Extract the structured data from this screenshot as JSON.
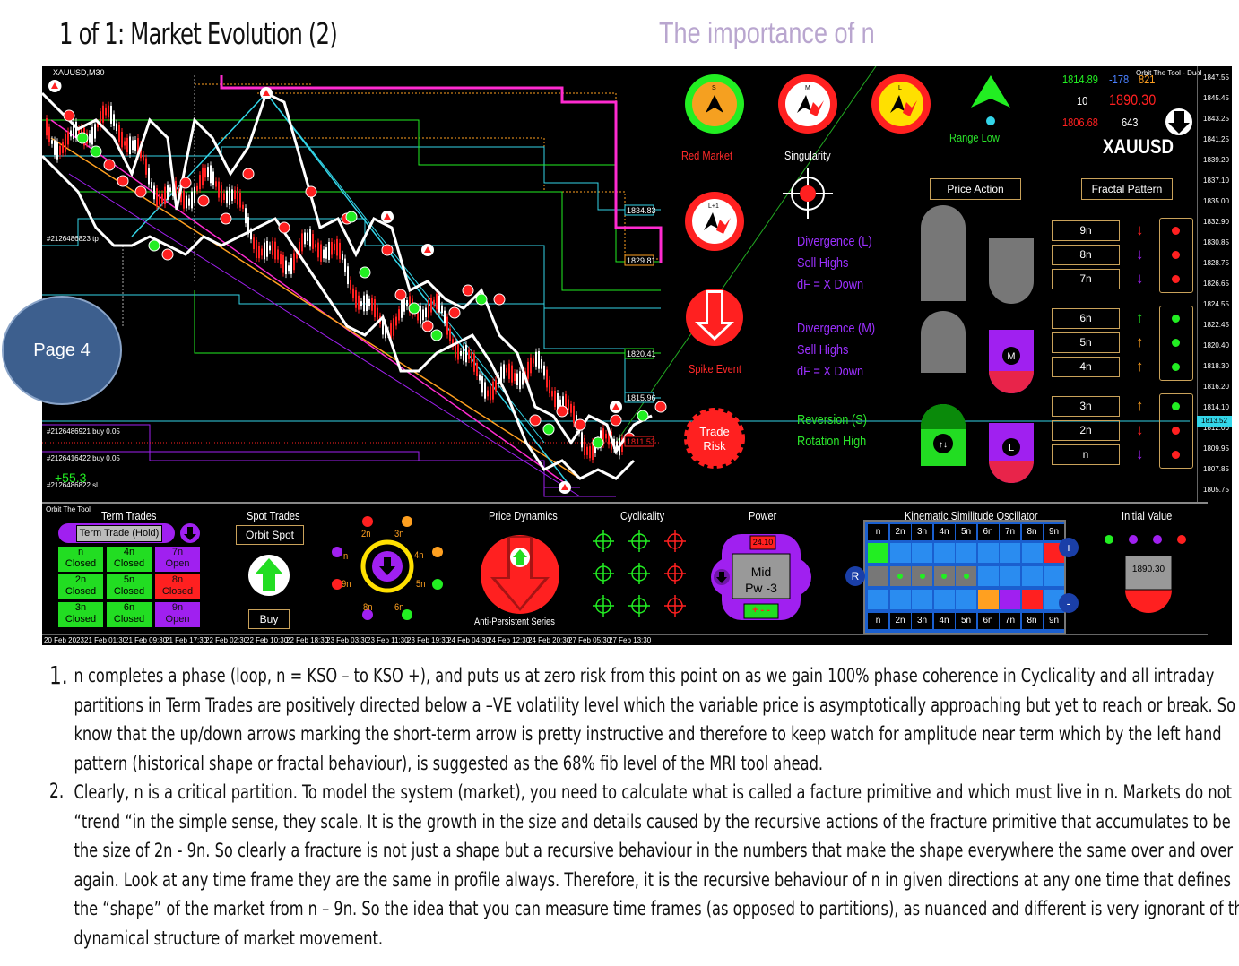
{
  "header": {
    "title": "1 of 1: Market Evolution (2)",
    "subtitle": "The importance of n"
  },
  "badge": {
    "label": "Page 4"
  },
  "platform": {
    "symbol_tf": "XAUUSD,M30",
    "tool_title": "Orbit The Tool - Dual",
    "bottom_title": "Orbit The Tool",
    "level_labels": [
      "1834.83",
      "1829.81",
      "1820.41",
      "1815.96",
      "1811.53"
    ],
    "order_labels": [
      "#2126486823 tp",
      "#2126486921 buy 0.05",
      "#2126416422 buy 0.05",
      "#2126486822 sl"
    ],
    "pnl": "+55.3",
    "price_scale": [
      "1847.55",
      "1845.45",
      "1843.25",
      "1841.25",
      "1839.20",
      "1837.10",
      "1835.00",
      "1832.90",
      "1830.85",
      "1828.75",
      "1826.65",
      "1824.55",
      "1822.45",
      "1820.40",
      "1818.30",
      "1816.20",
      "1814.10",
      "1812.00",
      "1809.95",
      "1807.85",
      "1805.75"
    ],
    "current_price": "1813.52",
    "time_axis": [
      "20 Feb 2023",
      "21 Feb 01:30",
      "21 Feb 09:30",
      "21 Feb 17:30",
      "22 Feb 02:30",
      "22 Feb 10:30",
      "22 Feb 18:30",
      "23 Feb 03:30",
      "23 Feb 11:30",
      "23 Feb 19:30",
      "24 Feb 04:30",
      "24 Feb 12:30",
      "24 Feb 20:30",
      "27 Feb 05:30",
      "27 Feb 13:30"
    ],
    "colors": {
      "red": "#ff2020",
      "green": "#22ee22",
      "purple": "#a020f0",
      "gold": "#c9a25a",
      "cyan": "#33d5e8",
      "magenta": "#ff2bd0"
    }
  },
  "indicators": {
    "red_market": "Red Market",
    "singularity": "Singularity",
    "spike_event": "Spike Event",
    "trade_risk": "Trade Risk",
    "range_low": "Range Low",
    "circle_letters": [
      "S",
      "M",
      "L",
      "L+1"
    ],
    "price_action_button": "Price Action",
    "fractal_pattern_button": "Fractal Pattern",
    "divergence_l": [
      "Divergence (L)",
      "Sell Highs",
      "dF = X Down"
    ],
    "divergence_m": [
      "Divergence (M)",
      "Sell Highs",
      "dF = X Down"
    ],
    "reversion_s": [
      "Reversion (S)",
      "Rotation High"
    ],
    "shape_letters": [
      "M",
      "L"
    ]
  },
  "quote": {
    "v1": "1814.89",
    "v2": "-178",
    "v3": "821",
    "v4": "10",
    "v5": "1890.30",
    "v6": "1806.68",
    "v7": "643",
    "symbol": "XAUUSD"
  },
  "partitions": [
    {
      "label": "9n",
      "arrow": "down",
      "arrow_color": "#ff2020",
      "dot": "#ff2020"
    },
    {
      "label": "8n",
      "arrow": "down",
      "arrow_color": "#a020f0",
      "dot": "#ff2020"
    },
    {
      "label": "7n",
      "arrow": "down",
      "arrow_color": "#a020f0",
      "dot": "#ff2020"
    },
    {
      "label": "6n",
      "arrow": "up",
      "arrow_color": "#22ee22",
      "dot": "#22ee22"
    },
    {
      "label": "5n",
      "arrow": "up",
      "arrow_color": "#ffa020",
      "dot": "#22ee22"
    },
    {
      "label": "4n",
      "arrow": "up",
      "arrow_color": "#ffa020",
      "dot": "#22ee22"
    },
    {
      "label": "3n",
      "arrow": "up",
      "arrow_color": "#ffa020",
      "dot": "#22ee22"
    },
    {
      "label": "2n",
      "arrow": "down",
      "arrow_color": "#ff2020",
      "dot": "#ff2020"
    },
    {
      "label": "n",
      "arrow": "down",
      "arrow_color": "#a020f0",
      "dot": "#ff2020"
    }
  ],
  "term_trades": {
    "title": "Term Trades",
    "mode_button": "Term Trade (Hold)",
    "cells": [
      {
        "n": "n",
        "s": "Closed",
        "c": "#22dd22"
      },
      {
        "n": "4n",
        "s": "Closed",
        "c": "#22dd22"
      },
      {
        "n": "7n",
        "s": "Open",
        "c": "#a020f0"
      },
      {
        "n": "2n",
        "s": "Closed",
        "c": "#22dd22"
      },
      {
        "n": "5n",
        "s": "Closed",
        "c": "#22dd22"
      },
      {
        "n": "8n",
        "s": "Closed",
        "c": "#ff2020"
      },
      {
        "n": "3n",
        "s": "Closed",
        "c": "#22dd22"
      },
      {
        "n": "6n",
        "s": "Closed",
        "c": "#22dd22"
      },
      {
        "n": "9n",
        "s": "Open",
        "c": "#a020f0"
      }
    ]
  },
  "spot_trades": {
    "title": "Spot Trades",
    "button": "Orbit Spot",
    "buy": "Buy"
  },
  "dial": {
    "labels": [
      "n",
      "2n",
      "3n",
      "4n",
      "5n",
      "6n",
      "8n",
      "9n"
    ]
  },
  "price_dynamics": {
    "title": "Price Dynamics",
    "caption": "Anti-Persistent Series"
  },
  "cyclicality": {
    "title": "Cyclicality"
  },
  "power": {
    "title": "Power",
    "value": "24.10",
    "mid": "Mid",
    "pw": "Pw -3",
    "pm": "+ - -"
  },
  "kso": {
    "title": "Kinematic Similitude Oscillator",
    "headers": [
      "n",
      "2n",
      "3n",
      "4n",
      "5n",
      "6n",
      "7n",
      "8n",
      "9n"
    ],
    "side_left": "R",
    "plus": "+",
    "minus": "-"
  },
  "initial_value": {
    "title": "Initial Value",
    "value": "1890.30"
  },
  "notes": [
    {
      "num": "1.",
      "text": "n completes a phase (loop, n = KSO – to KSO +), and puts us at zero risk from this point on as we gain 100%  phase coherence in Cyclicality and all intraday partitions in Term Trades are positively directed below a –VE volatility level which the variable price is asymptotically approaching but yet to reach or break. So I know that the up/down arrows marking the short-term arrow is pretty instructive and therefore to keep watch for amplitude near term which by the left hand pattern (historical shape or fractal behaviour), is suggested as the 68% fib level of the MRI tool ahead."
    },
    {
      "num": "2.",
      "text": "Clearly, n is a critical partition. To model the system (market), you need to calculate what is called a facture primitive and which must live in n. Markets do not “trend “in the simple sense, they scale. It is the growth in the size and details caused by the recursive actions of the fracture primitive that accumulates to be the size of 2n - 9n. So clearly a fracture is not just a shape but a recursive behaviour in the numbers that make the shape everywhere the same over and over again. Look at any time frame they are the same in profile always. Therefore, it is the recursive behaviour of n in given directions at any one time that defines the “shape” of the market from n – 9n. So the idea that you can measure time frames (as opposed to partitions), as nuanced and different is very ignorant of the dynamical structure of market movement."
    }
  ]
}
